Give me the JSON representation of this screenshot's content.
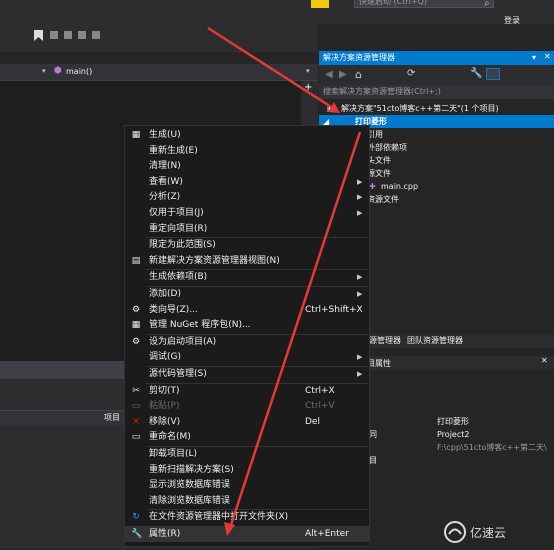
{
  "titlebar": {
    "quick_launch_placeholder": "快速启动 (Ctrl+Q)",
    "login": "登录"
  },
  "navbar": {
    "function_combo": "main()"
  },
  "solution_explorer": {
    "title": "解决方案资源管理器",
    "search_placeholder": "搜索解决方案资源管理器(Ctrl+;)",
    "tree": [
      {
        "label": "解决方案\"51cto博客c++第二天\"(1 个项目)",
        "selected": false
      },
      {
        "label": "打印菱形",
        "selected": true
      },
      {
        "label": "引用",
        "selected": false
      },
      {
        "label": "外部依赖项",
        "selected": false
      },
      {
        "label": "头文件",
        "selected": false
      },
      {
        "label": "源文件",
        "selected": false
      },
      {
        "label": "main.cpp",
        "selected": false
      },
      {
        "label": "资源文件",
        "selected": false
      }
    ],
    "tabs": [
      "源管理器",
      "团队资源管理器"
    ],
    "props_title": "目属性"
  },
  "properties": {
    "rows": [
      {
        "key": "",
        "value": "打印菱形"
      },
      {
        "key": "同",
        "value": "Project2"
      },
      {
        "key": "",
        "value": "F:\\cpp\\51cto博客c++第二天\\"
      },
      {
        "key": "目",
        "value": ""
      }
    ]
  },
  "bottom_left": {
    "column_header": "项目"
  },
  "context_menu": {
    "items": [
      {
        "label": "生成(U)",
        "shortcut": "",
        "submenu": false,
        "disabled": false,
        "icon": "build-icon"
      },
      {
        "label": "重新生成(E)",
        "shortcut": "",
        "submenu": false,
        "disabled": false,
        "icon": ""
      },
      {
        "label": "清理(N)",
        "shortcut": "",
        "submenu": false,
        "disabled": false,
        "icon": ""
      },
      {
        "label": "查看(W)",
        "shortcut": "",
        "submenu": true,
        "disabled": false,
        "icon": ""
      },
      {
        "label": "分析(Z)",
        "shortcut": "",
        "submenu": true,
        "disabled": false,
        "icon": ""
      },
      {
        "label": "仅用于项目(J)",
        "shortcut": "",
        "submenu": true,
        "disabled": false,
        "icon": ""
      },
      {
        "label": "重定向项目(R)",
        "shortcut": "",
        "submenu": false,
        "disabled": false,
        "icon": ""
      },
      {
        "label": "限定为此范围(S)",
        "shortcut": "",
        "submenu": false,
        "disabled": false,
        "icon": "",
        "sep_before": true
      },
      {
        "label": "新建解决方案资源管理器视图(N)",
        "shortcut": "",
        "submenu": false,
        "disabled": false,
        "icon": "new-view-icon"
      },
      {
        "label": "生成依赖项(B)",
        "shortcut": "",
        "submenu": true,
        "disabled": false,
        "icon": "",
        "sep_before": true
      },
      {
        "label": "添加(D)",
        "shortcut": "",
        "submenu": true,
        "disabled": false,
        "icon": "",
        "sep_before": true
      },
      {
        "label": "类向导(Z)...",
        "shortcut": "Ctrl+Shift+X",
        "submenu": false,
        "disabled": false,
        "icon": "class-wizard-icon"
      },
      {
        "label": "管理 NuGet 程序包(N)...",
        "shortcut": "",
        "submenu": false,
        "disabled": false,
        "icon": "nuget-icon"
      },
      {
        "label": "设为启动项目(A)",
        "shortcut": "",
        "submenu": false,
        "disabled": false,
        "icon": "gear-icon",
        "sep_before": true
      },
      {
        "label": "调试(G)",
        "shortcut": "",
        "submenu": true,
        "disabled": false,
        "icon": ""
      },
      {
        "label": "源代码管理(S)",
        "shortcut": "",
        "submenu": true,
        "disabled": false,
        "icon": "",
        "sep_before": true
      },
      {
        "label": "剪切(T)",
        "shortcut": "Ctrl+X",
        "submenu": false,
        "disabled": false,
        "icon": "scissors-icon",
        "sep_before": true
      },
      {
        "label": "粘贴(P)",
        "shortcut": "Ctrl+V",
        "submenu": false,
        "disabled": true,
        "icon": "paste-icon"
      },
      {
        "label": "移除(V)",
        "shortcut": "Del",
        "submenu": false,
        "disabled": false,
        "icon": "remove-icon"
      },
      {
        "label": "重命名(M)",
        "shortcut": "",
        "submenu": false,
        "disabled": false,
        "icon": "rename-icon"
      },
      {
        "label": "卸载项目(L)",
        "shortcut": "",
        "submenu": false,
        "disabled": false,
        "icon": "",
        "sep_before": true
      },
      {
        "label": "重新扫描解决方案(S)",
        "shortcut": "",
        "submenu": false,
        "disabled": false,
        "icon": ""
      },
      {
        "label": "显示浏览数据库错误",
        "shortcut": "",
        "submenu": false,
        "disabled": false,
        "icon": ""
      },
      {
        "label": "清除浏览数据库错误",
        "shortcut": "",
        "submenu": false,
        "disabled": false,
        "icon": ""
      },
      {
        "label": "在文件资源管理器中打开文件夹(X)",
        "shortcut": "",
        "submenu": false,
        "disabled": false,
        "icon": "refresh-icon",
        "sep_before": true
      },
      {
        "label": "属性(R)",
        "shortcut": "Alt+Enter",
        "submenu": false,
        "disabled": false,
        "icon": "wrench-icon",
        "sep_before": true,
        "highlight": true
      }
    ]
  },
  "watermark": {
    "text": "亿速云"
  },
  "colors": {
    "accent": "#007acc",
    "arrow": "#e53935",
    "menu_bg": "#1b1b1c"
  }
}
